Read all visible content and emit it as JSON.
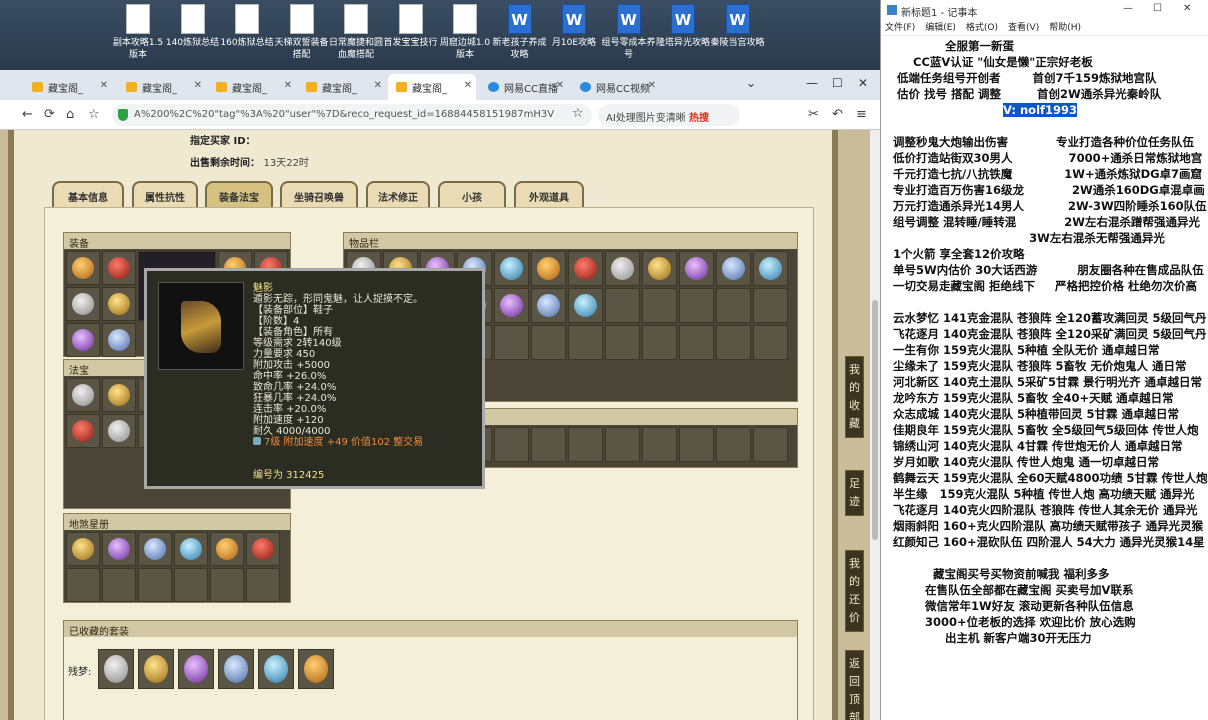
{
  "desktop": {
    "icons": [
      {
        "label": "副本攻略1.5版本",
        "type": "doc"
      },
      {
        "label": "140炼狱总结",
        "type": "doc"
      },
      {
        "label": "160炼狱总结",
        "type": "doc"
      },
      {
        "label": "天梯双誓装备搭配",
        "type": "doc"
      },
      {
        "label": "日常魔捷和圆血魔搭配",
        "type": "doc"
      },
      {
        "label": "首发宝宝技行",
        "type": "doc"
      },
      {
        "label": "周窟边城1.0版本",
        "type": "doc"
      },
      {
        "label": "新老孩子养成攻略",
        "type": "word"
      },
      {
        "label": "月10E攻略",
        "type": "word"
      },
      {
        "label": "组号零成本养号",
        "type": "word"
      },
      {
        "label": "隆塔异光攻略",
        "type": "word"
      },
      {
        "label": "秦陵当宫攻略",
        "type": "word"
      }
    ]
  },
  "browser": {
    "tabs": [
      {
        "label": "藏宝阁_"
      },
      {
        "label": "藏宝阁_"
      },
      {
        "label": "藏宝阁_"
      },
      {
        "label": "藏宝阁_"
      },
      {
        "label": "藏宝阁_"
      },
      {
        "label": "网易CC直播"
      },
      {
        "label": "网易CC视频"
      }
    ],
    "url": "A%200%2C%20\"tag\"%3A%20\"user\"%7D&reco_request_id=16884458151987mH3V",
    "search_placeholder": "AI处理图片变清晰",
    "search_hot": "热搜"
  },
  "game": {
    "buyer_label": "指定买家 ID：",
    "time_label": "出售剩余时间：",
    "time_value": "13天22时",
    "tabs": [
      "基本信息",
      "属性抗性",
      "装备法宝",
      "坐骑召唤兽",
      "法术修正",
      "小孩",
      "外观道具"
    ],
    "active_tab": 2,
    "panels": {
      "equip": "装备",
      "fabao": "法宝",
      "items": "物品栏",
      "lingshou": "地煞星册",
      "suits": "已收藏的套装",
      "suit_row": "残梦:"
    },
    "side_buttons": [
      "我的收藏",
      "足迹",
      "我的还价",
      "返回顶部"
    ]
  },
  "tooltip": {
    "name": "魅影",
    "desc": "遁影无踪，形同鬼魅，让人捉摸不定。",
    "lines": [
      "【装备部位】鞋子",
      "【阶数】4",
      "【装备角色】所有",
      "等级需求 2转140级",
      "力量要求 450",
      "附加攻击 +5000",
      "命中率 +26.0%",
      "致命几率 +24.0%",
      "狂暴几率 +24.0%",
      "连击率 +20.0%",
      "附加速度 +120",
      "耐久 4000/4000"
    ],
    "gem_line": "7级 附加速度 +49 价值102 整交易",
    "code": "编号为 312425"
  },
  "notepad": {
    "title": "新标题1 - 记事本",
    "menu": [
      "文件(F)",
      "编辑(E)",
      "格式(O)",
      "查看(V)",
      "帮助(H)"
    ],
    "lines_before": [
      "               全服第一新蛋",
      "       CC蓝V认证 \"仙女是懒\"正宗好老板",
      "   低端任务组号开创者        首创7千159炼狱地宫队",
      "   估价 找号 搭配 调整         首创2W通杀异光秦岭队"
    ],
    "highlight_line": "V: nolf1993",
    "lines_after": [
      "",
      "  调整秒鬼大炮输出伤害            专业打造各种价位任务队伍",
      "  低价打造站街双30男人              7000+通杀日常炼狱地宫",
      "  千元打造七抗/八抗铁魔             1W+通杀炼狱DG卓7画窟",
      "  专业打造百万伤害16级龙            2W通杀160DG卓混卓画",
      "  万元打造通杀异光14男人           2W-3W四阶睡杀160队伍",
      "  组号调整 混转睡/睡转混            2W左右混杀蹭帮强通异光",
      "                                    3W左右混杀无帮强通异光",
      "  1个火箭 享全套12价攻略",
      "  单号5W内估价 30大话西游          朋友圈各种在售成品队伍",
      "  一切交易走藏宝阁 拒绝线下     严格把控价格 杜绝勿次价高",
      "",
      "  云水梦忆 141克金混队 苍狼阵 全120蓄攻满回灵 5级回气丹",
      "  飞花逐月 140克金混队 苍狼阵 全120采矿满回灵 5级回气丹",
      "  一生有你 159克火混队 5种植 全队无价 通卓越日常",
      "  尘缘未了 159克火混队 苍狼阵 5畜牧 无价炮鬼人 通日常",
      "  河北新区 140克土混队 5采矿5甘霖 景行明光齐 通卓越日常",
      "  龙吟东方 159克火混队 5畜牧 全40+天赋 通卓越日常",
      "  众志成城 140克火混队 5种植带回灵 5甘霖 通卓越日常",
      "  佳期良年 159克火混队 5畜牧 全5级回气5级回体 传世人炮",
      "  锦绣山河 140克火混队 4甘霖 传世炮无价人 通卓越日常",
      "  岁月如歌 140克火混队 传世人炮鬼 通一切卓越日常",
      "  鹤舞云天 159克火混队 全60天赋4800功绩 5甘霖 传世人炮",
      "  半生缘   159克火混队 5种植 传世人炮 高功绩天赋 通异光",
      "  飞花逐月 140克火四阶混队 苍狼阵 传世人其余无价 通异光",
      "  烟雨斜阳 160+克火四阶混队 高功绩天赋带孩子 通异光灵猴",
      "  红颜知己 160+混砍队伍 四阶混人 54大力 通异光灵猴14星",
      "",
      "            藏宝阁买号买物资前喊我 福利多多",
      "          在售队伍全部都在藏宝阁 买卖号加V联系",
      "          微信常年1W好友 滚动更新各种队伍信息",
      "          3000+位老板的选择 欢迎比价 放心选购",
      "               出主机 新客户端30开无压力"
    ]
  }
}
